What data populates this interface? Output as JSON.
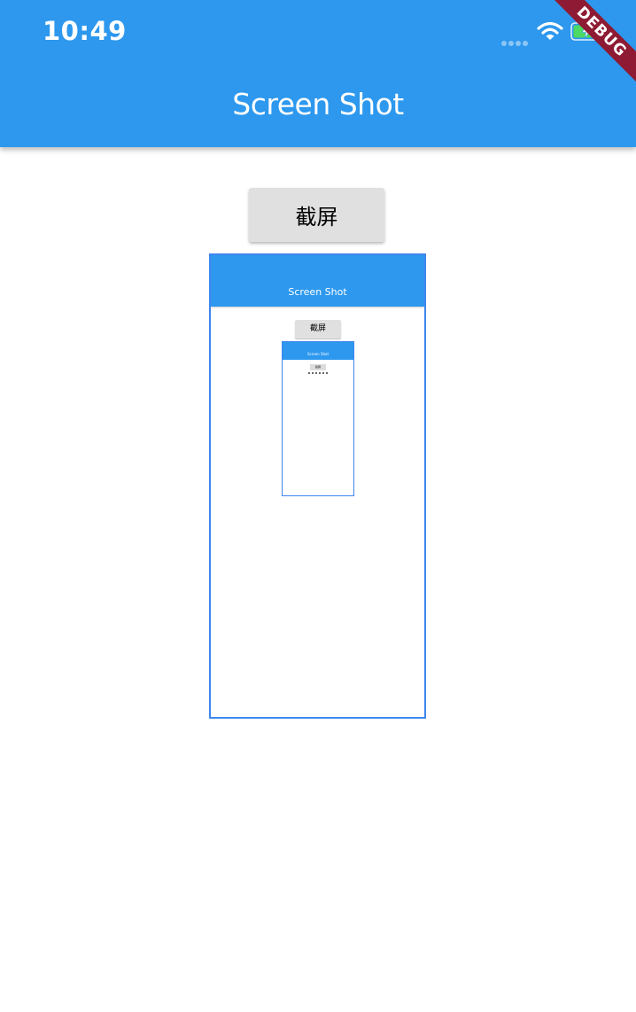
{
  "status_bar": {
    "time": "10:49",
    "icons": [
      "signal-dots-icon",
      "wifi-icon",
      "battery-charging-icon"
    ]
  },
  "app_bar": {
    "title": "Screen Shot",
    "color": "#2d98ee"
  },
  "debug_banner": {
    "label": "DEBUG",
    "color": "#8e1b33"
  },
  "main": {
    "capture_button_label": "截屏",
    "preview_border_color": "#3f86ee"
  },
  "preview": {
    "app_bar_title": "Screen Shot",
    "button_label": "截屏",
    "nested_preview": {
      "app_bar_title": "Screen Shot",
      "button_label": "截屏"
    }
  }
}
